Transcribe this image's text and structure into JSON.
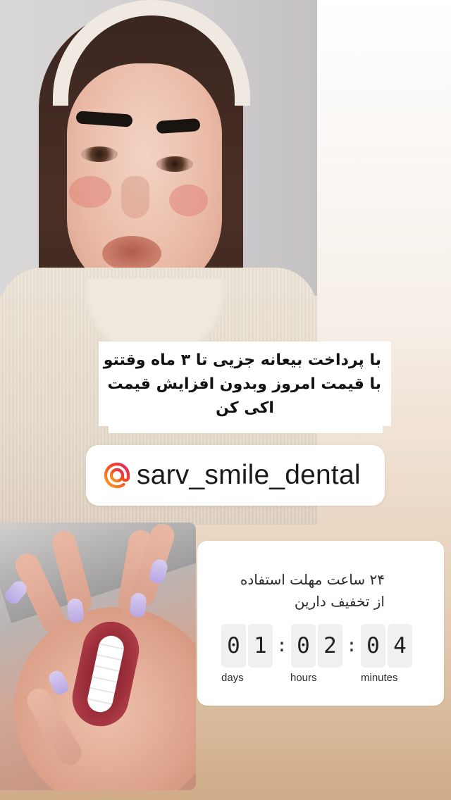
{
  "story": {
    "caption_lines": [
      "با پرداخت بیعانه جزیی تا ۳ ماه وقتتو",
      "با قیمت امروز وبدون افزایش قیمت",
      "اکی کن"
    ],
    "mention": {
      "username": "sarv_smile_dental",
      "icon": "threads-at-icon"
    },
    "countdown": {
      "title_lines": [
        "۲۴ ساعت مهلت استفاده",
        "از تخفیف دارین"
      ],
      "days_digits": [
        "0",
        "1"
      ],
      "hours_digits": [
        "0",
        "2"
      ],
      "minutes_digits": [
        "0",
        "4"
      ],
      "separator": ":",
      "labels": {
        "days": "days",
        "hours": "hours",
        "minutes": "minutes"
      }
    }
  },
  "colors": {
    "background_top": "#ffffff",
    "background_bottom": "#cfab88",
    "sticker": "#ffffff",
    "digit_tile": "#f0f0f0",
    "text": "#111111",
    "nail_polish": "#b8a7e3"
  }
}
